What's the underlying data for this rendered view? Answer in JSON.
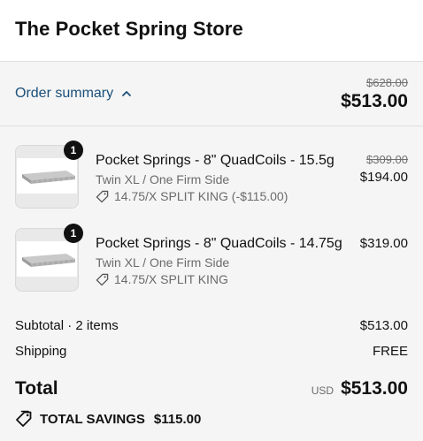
{
  "header": {
    "store_title": "The Pocket Spring Store"
  },
  "summary": {
    "toggle_label": "Order summary",
    "toggle_icon": "chevron-up-icon",
    "original_total": "$628.00",
    "total": "$513.00"
  },
  "items": [
    {
      "quantity": "1",
      "name": "Pocket Springs - 8\" QuadCoils - 15.5g",
      "variant": "Twin XL / One Firm Side",
      "discount": "14.75/X SPLIT KING (-$115.00)",
      "original_price": "$309.00",
      "price": "$194.00"
    },
    {
      "quantity": "1",
      "name": "Pocket Springs - 8\" QuadCoils - 14.75g",
      "variant": "Twin XL / One Firm Side",
      "discount": "14.75/X SPLIT KING",
      "price": "$319.00"
    }
  ],
  "totals": {
    "subtotal_label": "Subtotal · 2 items",
    "subtotal_value": "$513.00",
    "shipping_label": "Shipping",
    "shipping_value": "FREE",
    "total_label": "Total",
    "currency": "USD",
    "total_value": "$513.00",
    "savings_label": "TOTAL SAVINGS",
    "savings_value": "$115.00"
  },
  "colors": {
    "link": "#1b4f7a",
    "background": "#f5f5f5",
    "badge": "#111111"
  }
}
